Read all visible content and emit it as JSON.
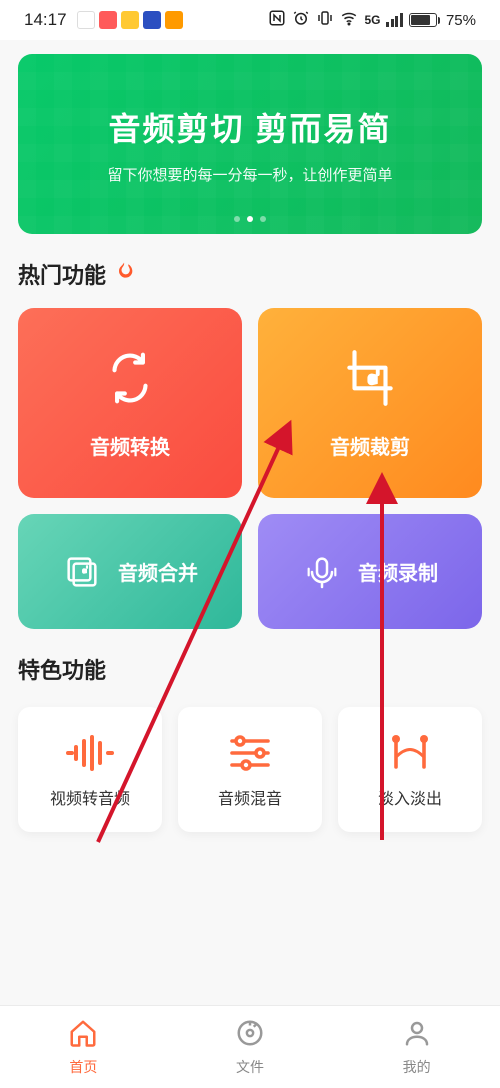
{
  "status": {
    "time": "14:17",
    "signal_label": "5G",
    "battery": "75%"
  },
  "banner": {
    "title": "音频剪切 剪而易简",
    "subtitle": "留下你想要的每一分每一秒，让创作更简单"
  },
  "sections": {
    "hot": "热门功能",
    "special": "特色功能"
  },
  "hot": {
    "convert": "音频转换",
    "crop": "音频裁剪",
    "merge": "音频合并",
    "record": "音频录制"
  },
  "feat": {
    "video2audio": "视频转音频",
    "mix": "音频混音",
    "fade": "淡入淡出"
  },
  "tabs": {
    "home": "首页",
    "files": "文件",
    "mine": "我的"
  },
  "colors": {
    "accent": "#ff6a3d"
  }
}
